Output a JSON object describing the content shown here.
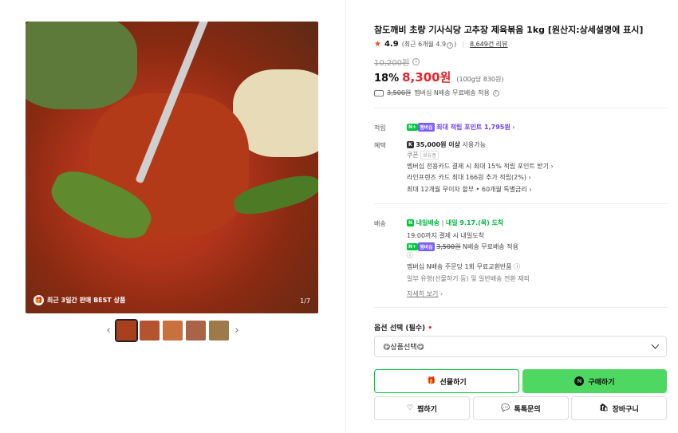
{
  "gallery": {
    "best_badge": "최근 3일간 판매 BEST 상품",
    "counter": "1/7",
    "prev_icon": "chevron-left-icon",
    "next_icon": "chevron-right-icon",
    "thumbnails": [
      "thumb-1",
      "thumb-2",
      "thumb-3",
      "thumb-4",
      "thumb-5"
    ]
  },
  "product": {
    "title": "참도깨비 초량 기사식당 고추장 제육볶음 1kg [원산지:상세설명에 표시]",
    "rating": "4.9",
    "rating_detail": "(최근 6개월 4.9",
    "rating_detail_end": ")",
    "review_count": "8,649건 리뷰",
    "original_price": "10,200원",
    "discount": "18%",
    "price": "8,300원",
    "unit_price": "(100g당 830원)",
    "shipping_fee_original": "3,500원",
    "shipping_note": "멤버십 N배송 무료배송 적용"
  },
  "benefits": {
    "point_label": "적립",
    "npay_badge": "N+",
    "membership_badge": "멤버십",
    "point_text": "최대 적립 포인트 1,795원",
    "benefit_label": "혜택",
    "coupon_amount": "35,000원 이상",
    "coupon_suffix": "사용가능",
    "coupon_label": "쿠폰",
    "coupon_tag": "보유중",
    "card_benefit": "멤버십 전용카드 결제 시 최대 15% 적립 포인트 받기",
    "line_benefit": "라인프렌즈 카드 최대 166원 추가 적립(2%)",
    "installment": "최대 12개월 무이자 할부 • 60개월 특별금리"
  },
  "delivery": {
    "label": "배송",
    "type": "내일배송",
    "arrival": "내일 9.17.(목) 도착",
    "cutoff": "19:00까지 결제 시 내일도착",
    "fee_original": "3,500원",
    "fee_note": "N배송 무료배송 적용",
    "return_note": "멤버십 N배송 주문당 1회 무료교환반품",
    "exception_note": "일부 유형(선물하기 등) 및 일반배송 전환 제외",
    "more": "자세히 보기"
  },
  "options": {
    "label": "옵션 선택 (필수)",
    "required_mark": "•",
    "selected": "😋상품선택😋"
  },
  "actions": {
    "gift": "선물하기",
    "buy": "구매하기",
    "wish": "찜하기",
    "talk": "톡톡문의",
    "cart": "장바구니"
  },
  "colors": {
    "accent_green": "#4fd861",
    "price_red": "#e52229",
    "point_purple": "#6a3cf0"
  }
}
